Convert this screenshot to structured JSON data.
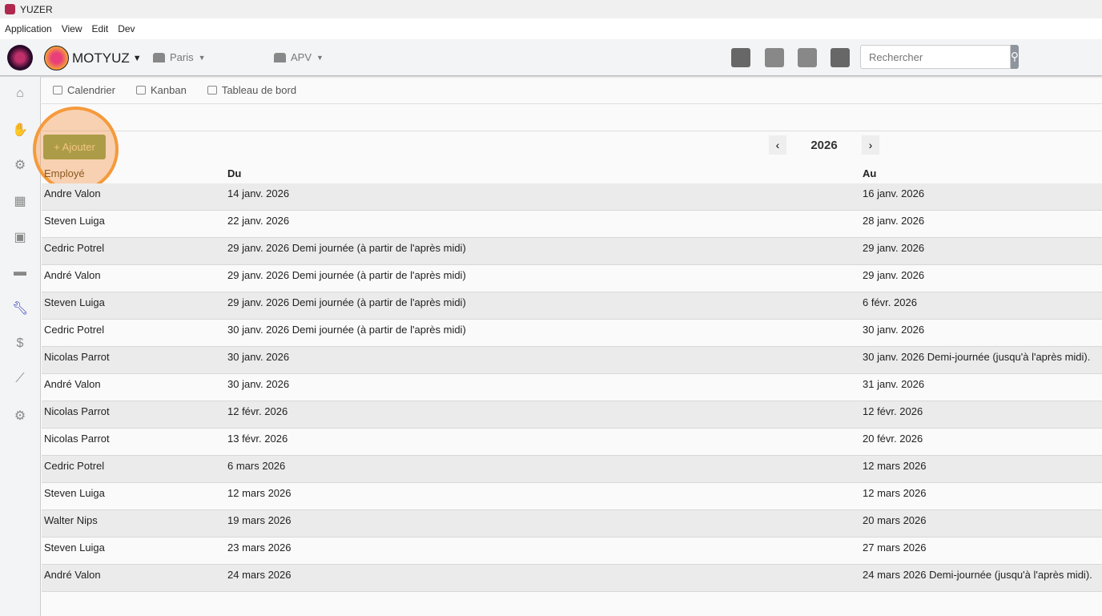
{
  "window": {
    "title": "YUZER"
  },
  "menu": [
    "Application",
    "View",
    "Edit",
    "Dev"
  ],
  "topbar": {
    "company": "MOTYUZ",
    "site": "Paris",
    "department": "APV",
    "search_placeholder": "Rechercher",
    "icons": [
      "cart-icon",
      "calendar-moto-icon",
      "calendar-wrench-icon",
      "cart-moto-icon"
    ]
  },
  "sidebar": [
    "home-icon",
    "handshake-icon",
    "motorcycle-icon",
    "boxes-icon",
    "warehouse-icon",
    "calendar-icon",
    "wrench-icon",
    "dollar-icon",
    "chart-icon",
    "settings-icon"
  ],
  "tabs": [
    "Calendrier",
    "Kanban",
    "Tableau de bord"
  ],
  "add_label": "+ Ajouter",
  "year": "2026",
  "columns": [
    "Employé",
    "Du",
    "Au"
  ],
  "rows": [
    [
      "Andre Valon",
      "14 janv. 2026",
      "16 janv. 2026"
    ],
    [
      "Steven Luiga",
      "22 janv. 2026",
      "28 janv. 2026"
    ],
    [
      "Cedric Potrel",
      "29 janv. 2026 Demi journée (à partir de l'après midi)",
      "29 janv. 2026"
    ],
    [
      "André Valon",
      "29 janv. 2026 Demi journée (à partir de l'après midi)",
      "29 janv. 2026"
    ],
    [
      "Steven Luiga",
      "29 janv. 2026 Demi journée (à partir de l'après midi)",
      "6 févr. 2026"
    ],
    [
      "Cedric Potrel",
      "30 janv. 2026 Demi journée (à partir de l'après midi)",
      "30 janv. 2026"
    ],
    [
      "Nicolas Parrot",
      "30 janv. 2026",
      "30 janv. 2026 Demi-journée (jusqu'à l'après midi)."
    ],
    [
      "André Valon",
      "30 janv. 2026",
      "31 janv. 2026"
    ],
    [
      "Nicolas Parrot",
      "12 févr. 2026",
      "12 févr. 2026"
    ],
    [
      "Nicolas Parrot",
      "13 févr. 2026",
      "20 févr. 2026"
    ],
    [
      "Cedric Potrel",
      "6 mars 2026",
      "12 mars 2026"
    ],
    [
      "Steven Luiga",
      "12 mars 2026",
      "12 mars 2026"
    ],
    [
      "Walter Nips",
      "19 mars 2026",
      "20 mars 2026"
    ],
    [
      "Steven Luiga",
      "23 mars 2026",
      "27 mars 2026"
    ],
    [
      "André Valon",
      "24 mars 2026",
      "24 mars 2026 Demi-journée (jusqu'à l'après midi)."
    ]
  ]
}
